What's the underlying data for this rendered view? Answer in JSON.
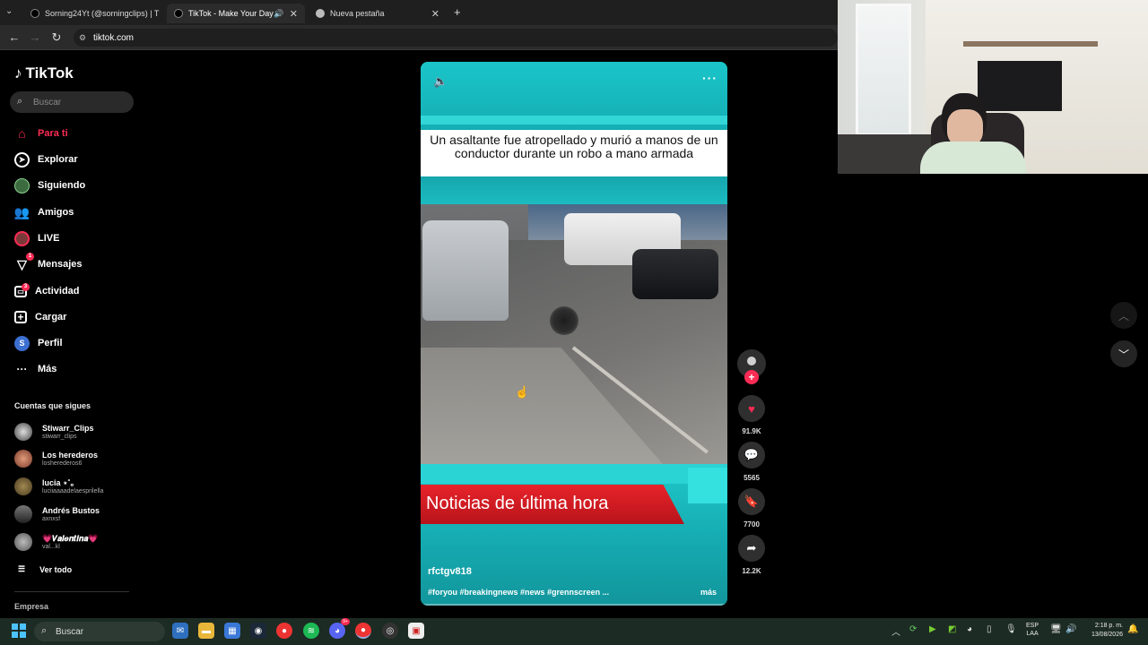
{
  "browser": {
    "tabs": [
      {
        "label": "Sorning24Yt (@sorningclips) | T",
        "active": false
      },
      {
        "label": "TikTok - Make Your Day",
        "active": true
      },
      {
        "label": "Nueva pestaña",
        "active": false
      }
    ],
    "new_tab": "+",
    "url": "tiktok.com"
  },
  "sidebar": {
    "logo": "TikTok",
    "search_placeholder": "Buscar",
    "nav": [
      {
        "label": "Para ti",
        "icon": "home-icon",
        "active": true
      },
      {
        "label": "Explorar",
        "icon": "compass-icon"
      },
      {
        "label": "Siguiendo",
        "icon": "following-avatar-icon"
      },
      {
        "label": "Amigos",
        "icon": "friends-icon"
      },
      {
        "label": "LIVE",
        "icon": "live-icon"
      },
      {
        "label": "Mensajes",
        "icon": "messages-icon",
        "badge": "1"
      },
      {
        "label": "Actividad",
        "icon": "activity-icon",
        "badge": "3"
      },
      {
        "label": "Cargar",
        "icon": "upload-icon"
      },
      {
        "label": "Perfil",
        "icon": "profile-icon"
      },
      {
        "label": "Más",
        "icon": "more-icon"
      }
    ],
    "following_title": "Cuentas que sigues",
    "accounts": [
      {
        "name": "Stiwarr_Clips",
        "handle": "stiwarr_clips"
      },
      {
        "name": "Los herederos",
        "handle": "losherederos6"
      },
      {
        "name": "lucia ⋆˚｡",
        "handle": "luciiaaaadelaesprilella"
      },
      {
        "name": "Andrés Bustos",
        "handle": "axnxsf"
      },
      {
        "name": "💗𝑽𝒂𝒍𝒆𝒏𝒕𝒊𝒏𝒂💗",
        "handle": "val...kl"
      }
    ],
    "see_all": "Ver todo",
    "footer": "Empresa"
  },
  "video": {
    "headline": "Un asaltante fue atropellado y murió a manos de un conductor durante un robo a mano armada",
    "banner": "Noticias de última hora",
    "author": "rfctgv818",
    "caption": "#foryou #breakingnews #news #grennscreen ...",
    "more": "más"
  },
  "actions": {
    "likes": "91.9K",
    "comments": "5565",
    "saves": "7700",
    "shares": "12.2K"
  },
  "taskbar": {
    "search": "Buscar",
    "lang_line1": "ESP",
    "lang_line2": "LAA",
    "time": "2:18 p. m.",
    "date": "13/08/2026",
    "discord_badge": "9+"
  },
  "colors": {
    "accent": "#fe2c55",
    "video_teal": "#1bbcc0",
    "banner_red": "#d61c24"
  }
}
